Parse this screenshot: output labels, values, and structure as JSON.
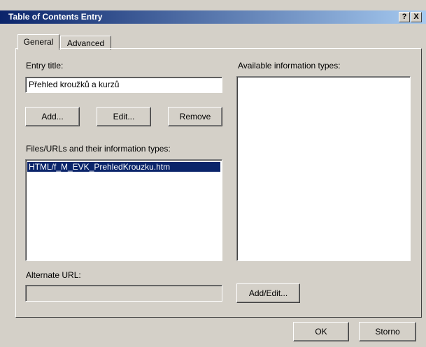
{
  "dialog": {
    "title": "Table of Contents Entry",
    "help_button": "?",
    "close_button": "X"
  },
  "tabs": [
    {
      "label": "General",
      "selected": true
    },
    {
      "label": "Advanced",
      "selected": false
    }
  ],
  "general": {
    "entry_title_label": "Entry title:",
    "entry_title_value": "Přehled kroužků a  kurzů",
    "add_button": "Add...",
    "edit_button": "Edit...",
    "remove_button": "Remove",
    "files_label": "Files/URLs and their information types:",
    "files": [
      "HTML/f_M_EVK_PrehledKrouzku.htm"
    ],
    "available_types_label": "Available information types:",
    "available_types": [],
    "alternate_url_label": "Alternate URL:",
    "alternate_url_value": "",
    "add_edit_button": "Add/Edit..."
  },
  "footer": {
    "ok_button": "OK",
    "cancel_button": "Storno"
  }
}
